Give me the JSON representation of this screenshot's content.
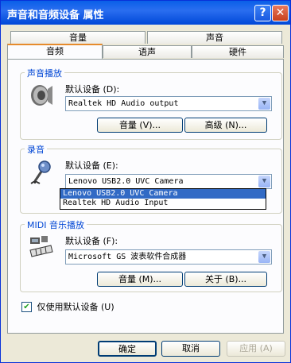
{
  "window": {
    "title": "声音和音频设备 属性",
    "help_label": "?",
    "close_label": "✕"
  },
  "tabs": {
    "row1": [
      "音量",
      "声音"
    ],
    "row2": [
      "音频",
      "语声",
      "硬件"
    ],
    "active": "音频"
  },
  "playback": {
    "group_label": "声音播放",
    "default_label": "默认设备 (D):",
    "device": "Realtek HD Audio output",
    "volume_button": "音量 (V)...",
    "advanced_button": "高级 (N)...",
    "icon": "speaker-icon"
  },
  "recording": {
    "group_label": "录音",
    "default_label": "默认设备 (E):",
    "device": "Lenovo USB2.0 UVC Camera",
    "options": [
      "Lenovo USB2.0 UVC Camera",
      "Realtek HD Audio Input"
    ],
    "icon": "microphone-icon"
  },
  "midi": {
    "group_label": "MIDI 音乐播放",
    "default_label": "默认设备 (F):",
    "device": "Microsoft GS 波表软件合成器",
    "volume_button": "音量 (M)...",
    "about_button": "关于 (B)...",
    "icon": "midi-keyboard-icon"
  },
  "default_only": {
    "label": "仅使用默认设备 (U)",
    "checked": true
  },
  "footer": {
    "ok": "确定",
    "cancel": "取消",
    "apply": "应用 (A)"
  }
}
